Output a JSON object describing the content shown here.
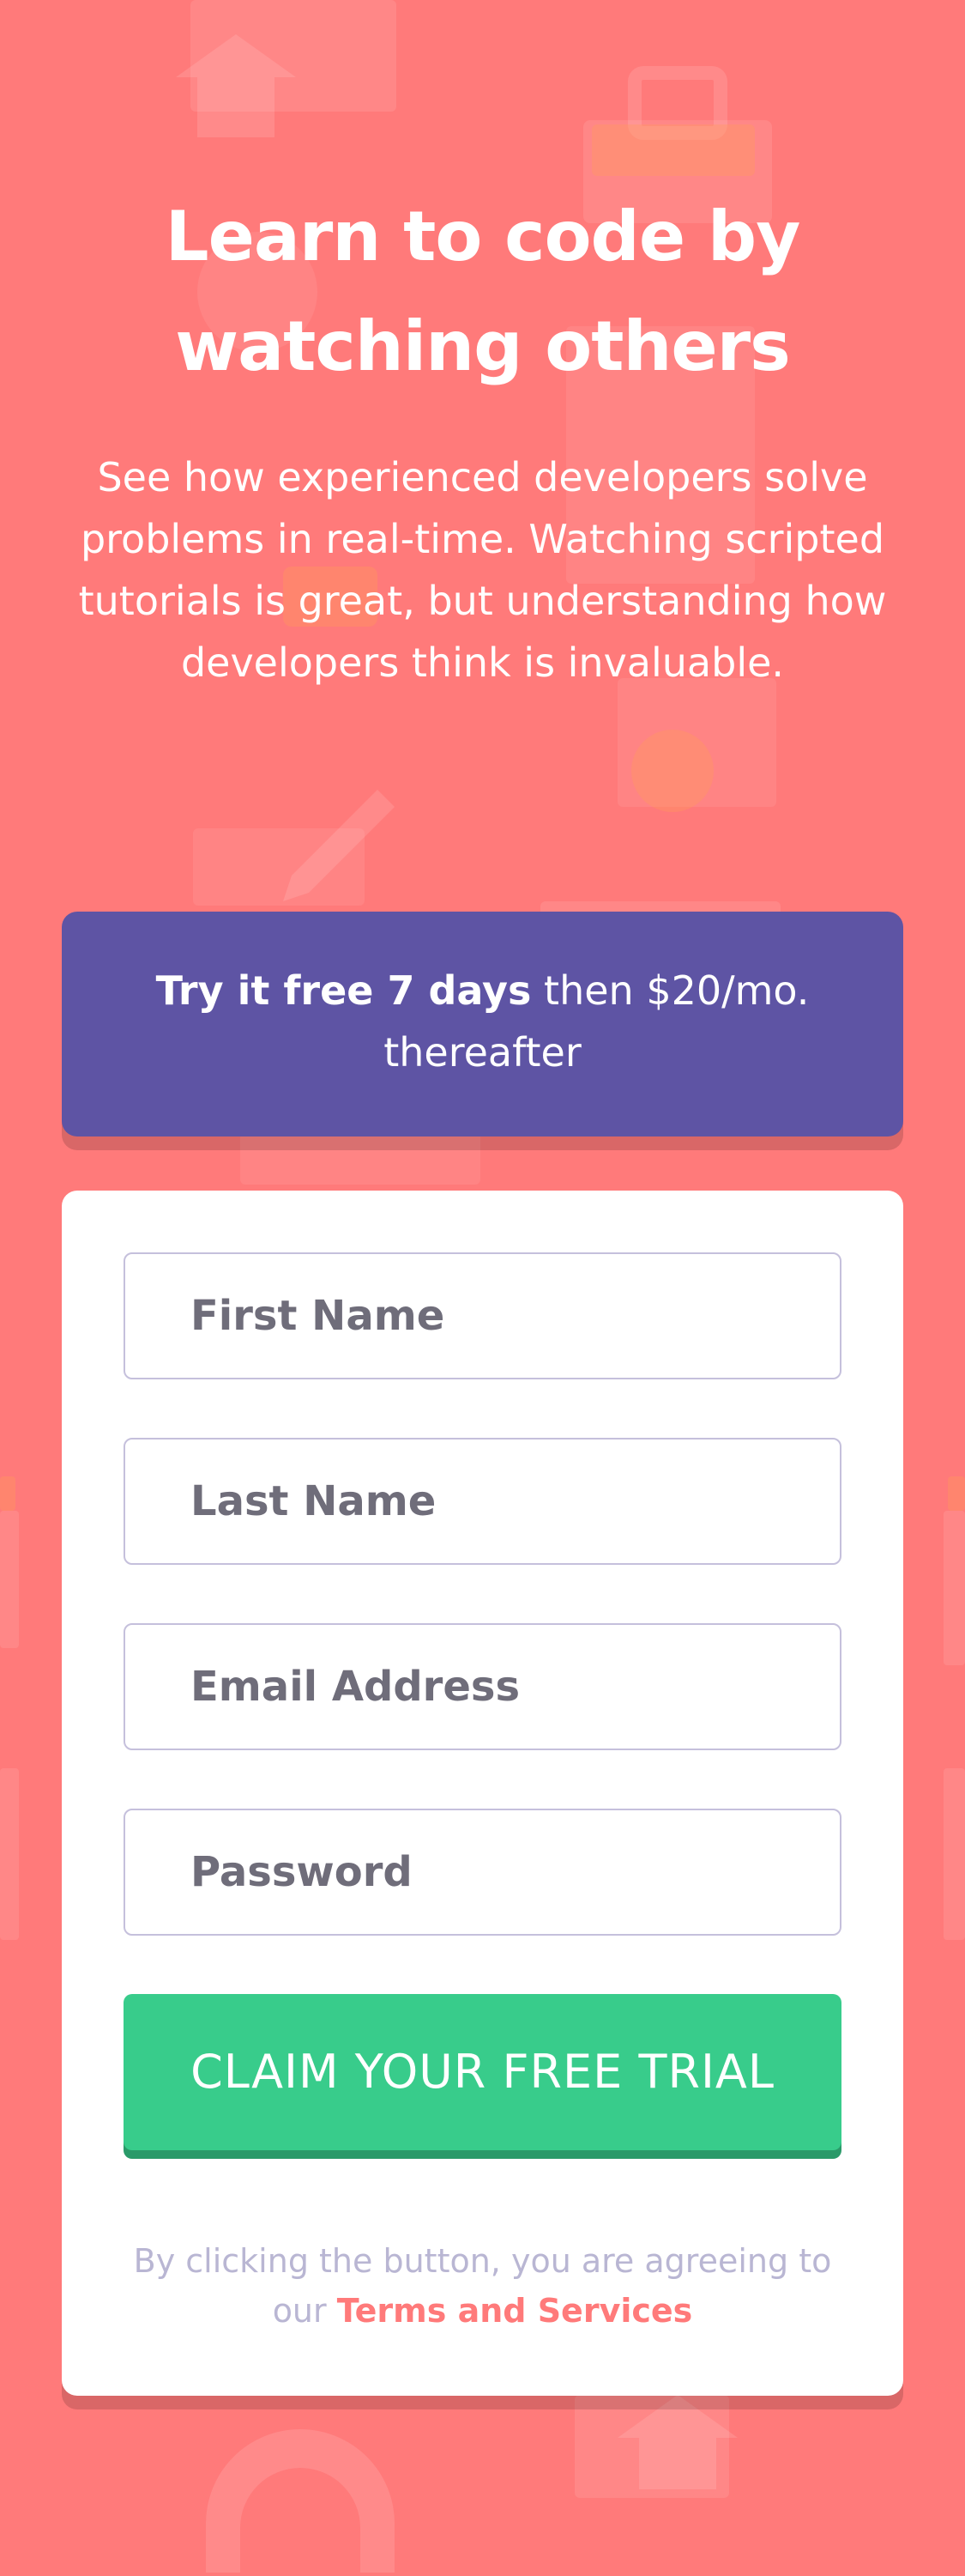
{
  "hero": {
    "title": "Learn to code by watching others",
    "description": "See how experienced developers solve problems in real-time. Watching scripted tutorials is great, but understanding how developers think is invaluable."
  },
  "promo": {
    "bold": "Try it free 7 days",
    "rest": " then $20/mo. thereafter"
  },
  "form": {
    "first_name_placeholder": "First Name",
    "last_name_placeholder": "Last Name",
    "email_placeholder": "Email Address",
    "password_placeholder": "Password",
    "cta_label": "CLAIM YOUR FREE TRIAL",
    "terms_prefix": "By clicking the button, you are agreeing to our ",
    "terms_link": "Terms and Services"
  },
  "colors": {
    "background": "#ff7a7a",
    "promo": "#5e54a4",
    "cta": "#38cc8b",
    "terms_link": "#ff7a7a"
  },
  "icons": {
    "background_pattern": [
      "home-icon",
      "toolbox-icon",
      "gear-icon",
      "pencil-icon",
      "document-icon",
      "headphones-icon"
    ]
  }
}
